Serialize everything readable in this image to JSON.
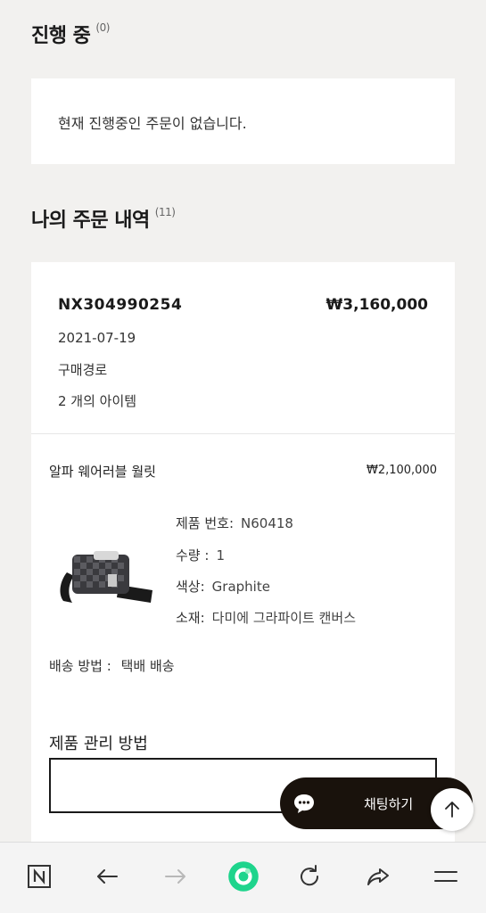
{
  "in_progress": {
    "title": "진행 중",
    "count": "(0)",
    "empty_message": "현재 진행중인 주문이 없습니다."
  },
  "history": {
    "title": "나의 주문 내역",
    "count": "(11)"
  },
  "order": {
    "number": "NX304990254",
    "total": "₩3,160,000",
    "date": "2021-07-19",
    "route_label": "구매경로",
    "item_count": "2 개의 아이템",
    "item": {
      "name": "알파 웨어러블 월릿",
      "price": "₩2,100,000",
      "product_no_label": "제품 번호:",
      "product_no": "N60418",
      "qty_label": "수량 :",
      "qty": "1",
      "color_label": "색상:",
      "color": "Graphite",
      "material_label": "소재:",
      "material": "다미에 그라파이트 캔버스"
    },
    "shipping_label": "배송 방법 :",
    "shipping_value": "택배 배송",
    "care_title": "제품 관리 방법"
  },
  "chat": {
    "label": "채팅하기"
  },
  "browser_bar": {
    "icons": [
      "n-logo-icon",
      "back-icon",
      "forward-icon",
      "home-circle-icon",
      "reload-icon",
      "share-icon",
      "menu-icon"
    ]
  },
  "colors": {
    "background": "#f2f1ef",
    "card": "#ffffff",
    "chat_button": "#19120c",
    "home_accent": "#1ed48c"
  }
}
